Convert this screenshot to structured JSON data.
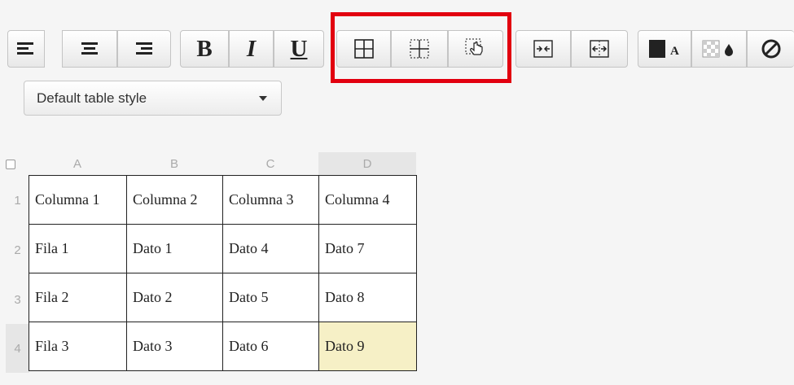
{
  "toolbar": {
    "bold_label": "B",
    "italic_label": "I",
    "underline_label": "U",
    "icons": [
      "align-left-icon",
      "align-center-icon",
      "align-right-icon",
      "table-all-borders-icon",
      "table-dashed-borders-icon",
      "table-pointer-hand-icon",
      "merge-cells-icon",
      "split-cells-icon",
      "text-color-icon",
      "background-color-icon",
      "clear-format-icon"
    ],
    "text_color_letter": "A",
    "highlight_color": "#e2000f"
  },
  "style_select": {
    "selected": "Default table style"
  },
  "sheet": {
    "column_headers": [
      "A",
      "B",
      "C",
      "D"
    ],
    "row_headers": [
      "1",
      "2",
      "3",
      "4"
    ],
    "rows": [
      [
        "Columna 1",
        "Columna 2",
        "Columna 3",
        "Columna 4"
      ],
      [
        "Fila 1",
        "Dato 1",
        "Dato 4",
        "Dato 7"
      ],
      [
        "Fila 2",
        "Dato 2",
        "Dato 5",
        "Dato 8"
      ],
      [
        "Fila 3",
        "Dato 3",
        "Dato 6",
        "Dato 9"
      ]
    ],
    "selected_cell": "D4",
    "selected_cell_color": "#f6f0c6"
  }
}
